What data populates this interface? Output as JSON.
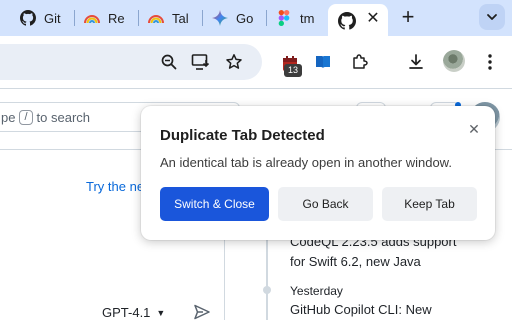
{
  "tabs": [
    {
      "label": "Git",
      "icon": "github-icon"
    },
    {
      "label": "Re",
      "icon": "rainbow-icon"
    },
    {
      "label": "Tal",
      "icon": "rainbow-icon"
    },
    {
      "label": "Go",
      "icon": "gemini-icon"
    },
    {
      "label": "tm",
      "icon": "figma-icon"
    }
  ],
  "active_tab": {
    "icon": "github-icon",
    "close_glyph": "✕"
  },
  "new_tab_glyph": "+",
  "toolbar": {
    "extension_badge": "13"
  },
  "page": {
    "search_prefix": "pe",
    "search_key": "/",
    "search_suffix": "to search",
    "try_link": "Try the ne",
    "model_name": "GPT-4.1",
    "model_caret": "▼",
    "feed_line1": "CodeQL 2.23.5 adds support",
    "feed_line2": "for Swift 6.2, new Java",
    "feed_date": "Yesterday",
    "feed_line3": "GitHub Copilot CLI: New"
  },
  "dialog": {
    "title": "Duplicate Tab Detected",
    "message": "An identical tab is already open in another window.",
    "close_glyph": "✕",
    "primary_button": "Switch & Close",
    "back_button": "Go Back",
    "keep_button": "Keep Tab"
  },
  "colors": {
    "tabstrip": "#d3e3fd",
    "primary": "#1a56db",
    "link": "#0969da"
  }
}
